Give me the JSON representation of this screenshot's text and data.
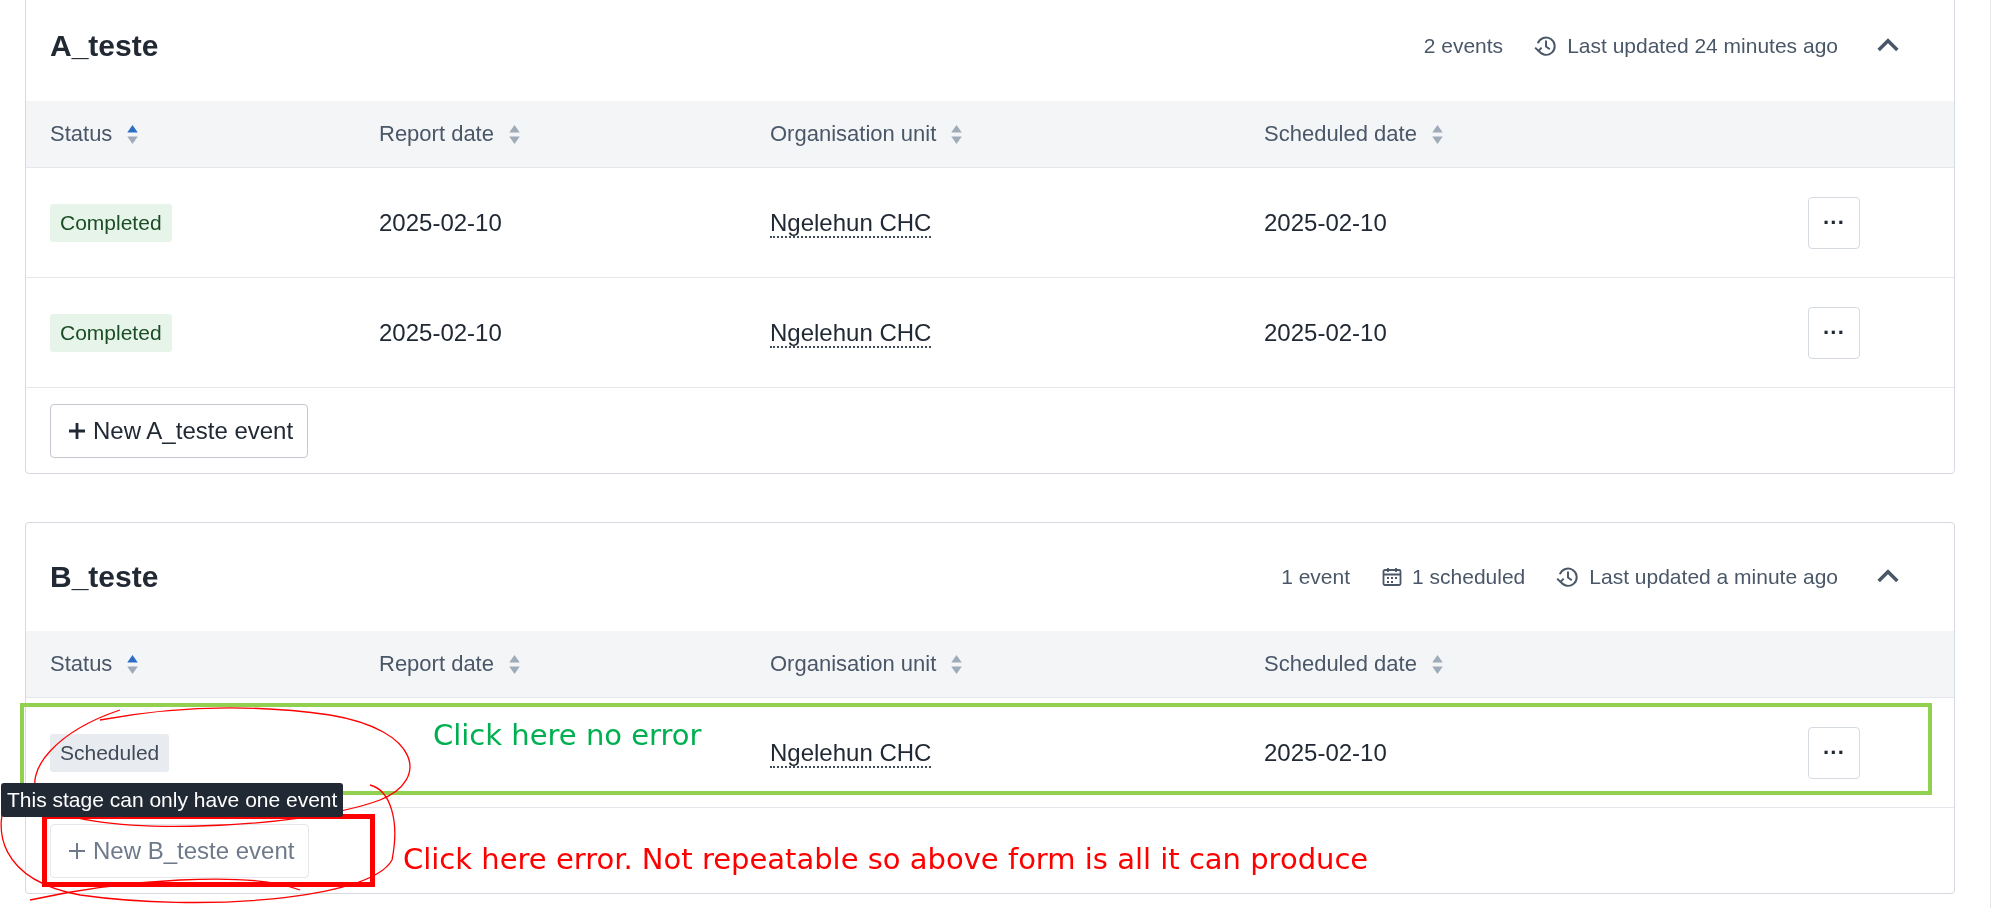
{
  "stages": [
    {
      "title": "A_teste",
      "meta": [
        {
          "kind": "count",
          "text": "2 events"
        },
        {
          "kind": "updated",
          "text": "Last updated 24 minutes ago"
        }
      ],
      "expanded": true,
      "columns": [
        {
          "label": "Status",
          "sorted": true
        },
        {
          "label": "Report date",
          "sorted": false
        },
        {
          "label": "Organisation unit",
          "sorted": false
        },
        {
          "label": "Scheduled date",
          "sorted": false
        }
      ],
      "rows": [
        {
          "status": "Completed",
          "kind": "completed",
          "report_date": "2025-02-10",
          "org_unit": "Ngelehun CHC",
          "scheduled_date": "2025-02-10",
          "menu": "···"
        },
        {
          "status": "Completed",
          "kind": "completed",
          "report_date": "2025-02-10",
          "org_unit": "Ngelehun CHC",
          "scheduled_date": "2025-02-10",
          "menu": "···"
        }
      ],
      "new_event_button": {
        "label": "New A_teste event",
        "disabled": false
      }
    },
    {
      "title": "B_teste",
      "meta": [
        {
          "kind": "count",
          "text": "1 event"
        },
        {
          "kind": "scheduled",
          "text": "1 scheduled"
        },
        {
          "kind": "updated",
          "text": "Last updated a minute ago"
        }
      ],
      "expanded": true,
      "columns": [
        {
          "label": "Status",
          "sorted": true
        },
        {
          "label": "Report date",
          "sorted": false
        },
        {
          "label": "Organisation unit",
          "sorted": false
        },
        {
          "label": "Scheduled date",
          "sorted": false
        }
      ],
      "rows": [
        {
          "status": "Scheduled",
          "kind": "scheduled",
          "report_date": "",
          "org_unit": "Ngelehun CHC",
          "scheduled_date": "2025-02-10",
          "menu": "···"
        }
      ],
      "new_event_button": {
        "label": "New B_teste event",
        "disabled": true,
        "tooltip": "This stage can only have one event"
      }
    }
  ],
  "annotations": [
    {
      "kind": "rect",
      "color": "#92d050"
    },
    {
      "kind": "text",
      "color": "#00b050",
      "text": "Click here no error"
    },
    {
      "kind": "rect",
      "color": "#ff0000"
    },
    {
      "kind": "text",
      "color": "#ff0000",
      "text": "Click here error. Not repeatable so above form is all it can produce"
    },
    {
      "kind": "scribble",
      "color": "#ff0000"
    }
  ]
}
